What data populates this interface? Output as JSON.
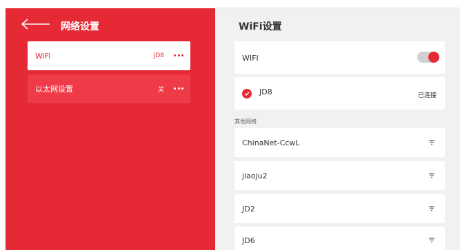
{
  "left": {
    "title": "网络设置",
    "menu": [
      {
        "label": "WiFi",
        "status": "JD8",
        "active": true
      },
      {
        "label": "以太网设置",
        "status": "关",
        "active": false
      }
    ]
  },
  "right": {
    "title": "WiFi设置",
    "wifi_toggle": {
      "label": "WIFI",
      "on": true
    },
    "connected": {
      "ssid": "JD8",
      "status": "已连接"
    },
    "section_label": "其他网络",
    "networks": [
      {
        "ssid": "ChinaNet-CcwL"
      },
      {
        "ssid": "jiaoju2"
      },
      {
        "ssid": "JD2"
      },
      {
        "ssid": "JD6"
      }
    ]
  },
  "colors": {
    "accent": "#e52935",
    "panel": "#f1f1f1"
  }
}
